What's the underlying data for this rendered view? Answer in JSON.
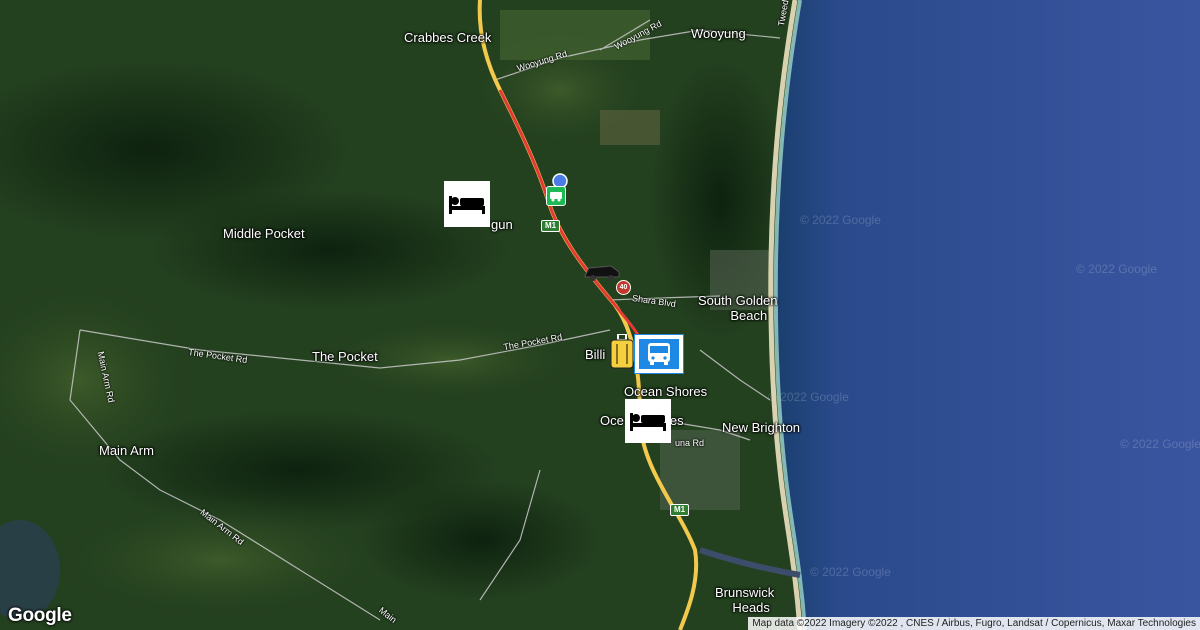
{
  "places": {
    "crabbes_creek": "Crabbes Creek",
    "wooyung": "Wooyung",
    "middle_pocket": "Middle Pocket",
    "mooball_partial": "gun",
    "south_golden_beach": "South Golden",
    "south_golden_beach_2": "Beach",
    "the_pocket": "The Pocket",
    "billinudgel_partial": "Billi",
    "ocean_shores": "Ocean Shores",
    "ocean_shores_2_a": "Oce",
    "ocean_shores_2_b": "es",
    "new_brighton": "New Brighton",
    "main_arm": "Main Arm",
    "brunswick_heads": "Brunswick",
    "brunswick_heads_2": "Heads"
  },
  "roads": {
    "wooyung_rd_1": "Wooyung Rd",
    "wooyung_rd_2": "Wooyung Rd",
    "tweed": "Tweed",
    "the_pocket_rd_1": "The Pocket Rd",
    "the_pocket_rd_2": "The Pocket Rd",
    "main_arm_rd_1": "Main Arm Rd",
    "main_arm_rd_2": "Main Arm Rd",
    "main_arm_rd_3": "Main",
    "shara_blvd": "Shara Blvd",
    "luna_rd": "una Rd",
    "m1_a": "M1",
    "m1_b": "M1",
    "speed_40": "40"
  },
  "watermarks": [
    "© 2022 Google",
    "© 2022 Google",
    "© 2022 Google",
    "© 2022 Google",
    "© 2022 Google"
  ],
  "icons": [
    "hotel-icon",
    "hotel-icon",
    "bus-icon",
    "luggage-icon",
    "car-icon",
    "camper-icon",
    "location-dot-icon"
  ],
  "colors": {
    "route": "#e53935",
    "highway": "#f2c94c",
    "ocean": "#2c3f8a",
    "poi_green": "#1db954",
    "bus_blue": "#1e88e5",
    "luggage_yellow": "#f4d03f"
  },
  "attribution": "Map data ©2022 Imagery ©2022 , CNES / Airbus, Fugro, Landsat / Copernicus, Maxar Technologies",
  "logo": "Google"
}
